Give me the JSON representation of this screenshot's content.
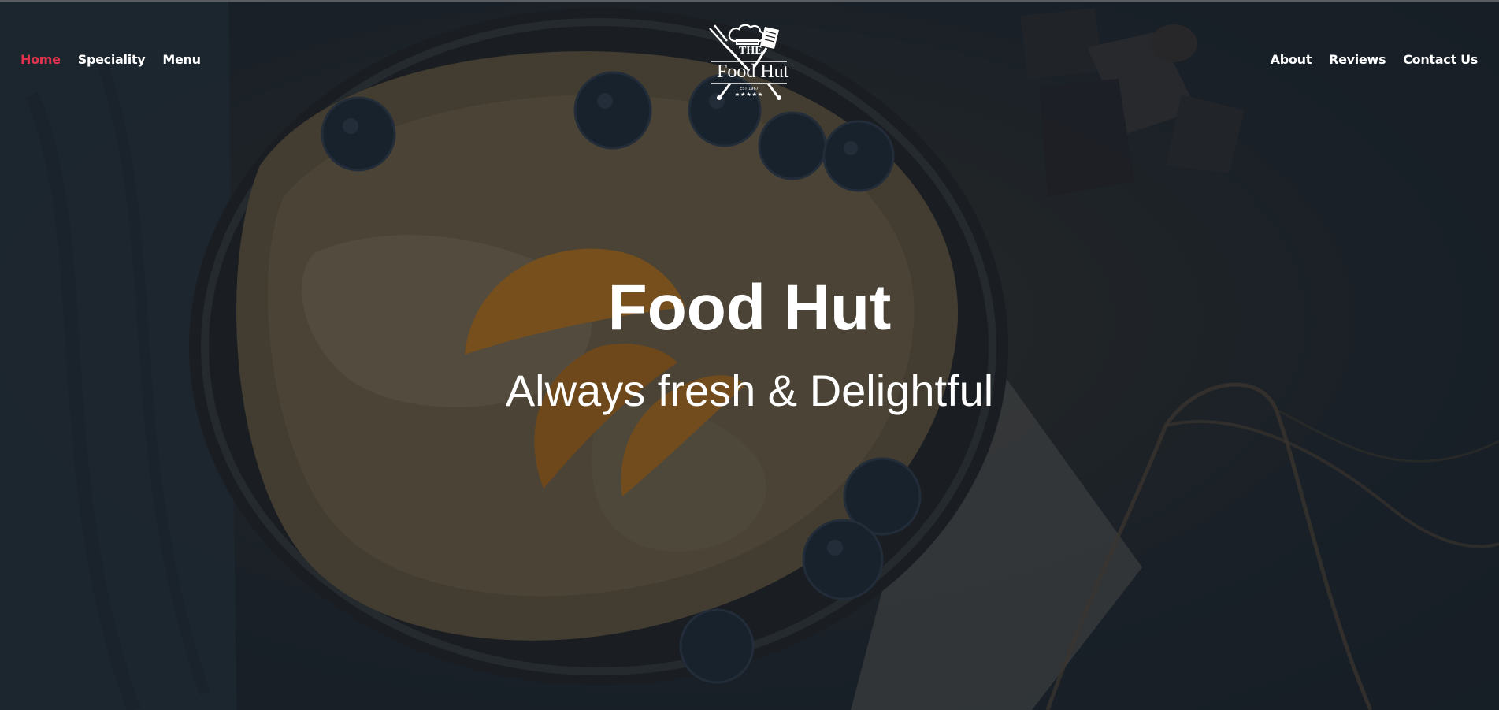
{
  "nav": {
    "left": [
      {
        "label": "Home",
        "active": true
      },
      {
        "label": "Speciality",
        "active": false
      },
      {
        "label": "Menu",
        "active": false
      }
    ],
    "right": [
      {
        "label": "About",
        "active": false
      },
      {
        "label": "Reviews",
        "active": false
      },
      {
        "label": "Contact Us",
        "active": false
      }
    ]
  },
  "logo": {
    "the": "THE",
    "name": "Food Hut",
    "est": "EST 1967",
    "stars": "★★★★★",
    "icons": [
      "chef-hat-icon",
      "fork-icon",
      "spatula-icon"
    ]
  },
  "hero": {
    "title": "Food Hut",
    "subtitle": "Always fresh & Delightful"
  },
  "colors": {
    "active_link": "#e3334f",
    "text": "#ffffff",
    "background": "#1b222a"
  }
}
